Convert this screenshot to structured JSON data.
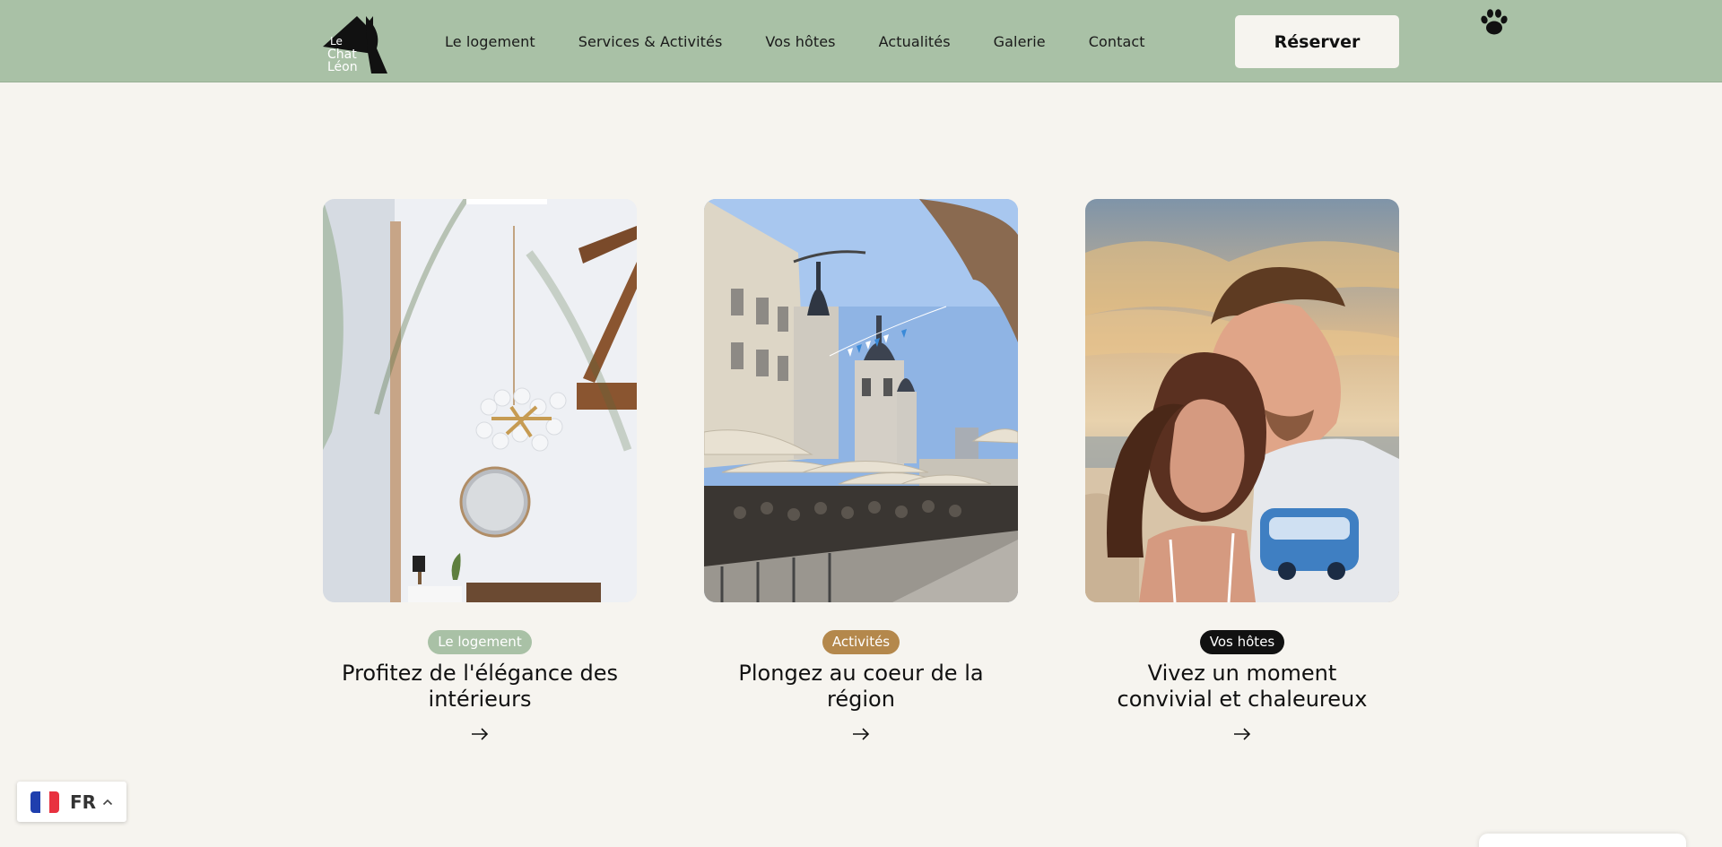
{
  "header": {
    "logo_text": [
      "Le",
      "Chat",
      "Léon"
    ],
    "nav": [
      "Le logement",
      "Services & Activités",
      "Vos hôtes",
      "Actualités",
      "Galerie",
      "Contact"
    ],
    "reserve_label": "Réserver",
    "paw_icon": "paw-icon"
  },
  "cards": [
    {
      "badge": "Le logement",
      "badge_color": "#a9c1a6",
      "title_lines": [
        "Profitez de l'élégance des",
        "intérieurs"
      ],
      "image": "interior-photo"
    },
    {
      "badge": "Activités",
      "badge_color": "#b4884c",
      "title_lines": [
        "Plongez au coeur de la",
        "région"
      ],
      "image": "town-square-photo"
    },
    {
      "badge": "Vos hôtes",
      "badge_color": "#111111",
      "title_lines": [
        "Vivez un moment",
        "convivial et chaleureux"
      ],
      "image": "hosts-photo"
    }
  ],
  "language": {
    "code": "FR",
    "flag_colors": [
      "#1f3fae",
      "#ffffff",
      "#e8313f"
    ]
  },
  "colors": {
    "header_bg": "#a9c1a6",
    "page_bg": "#f6f4ef"
  }
}
